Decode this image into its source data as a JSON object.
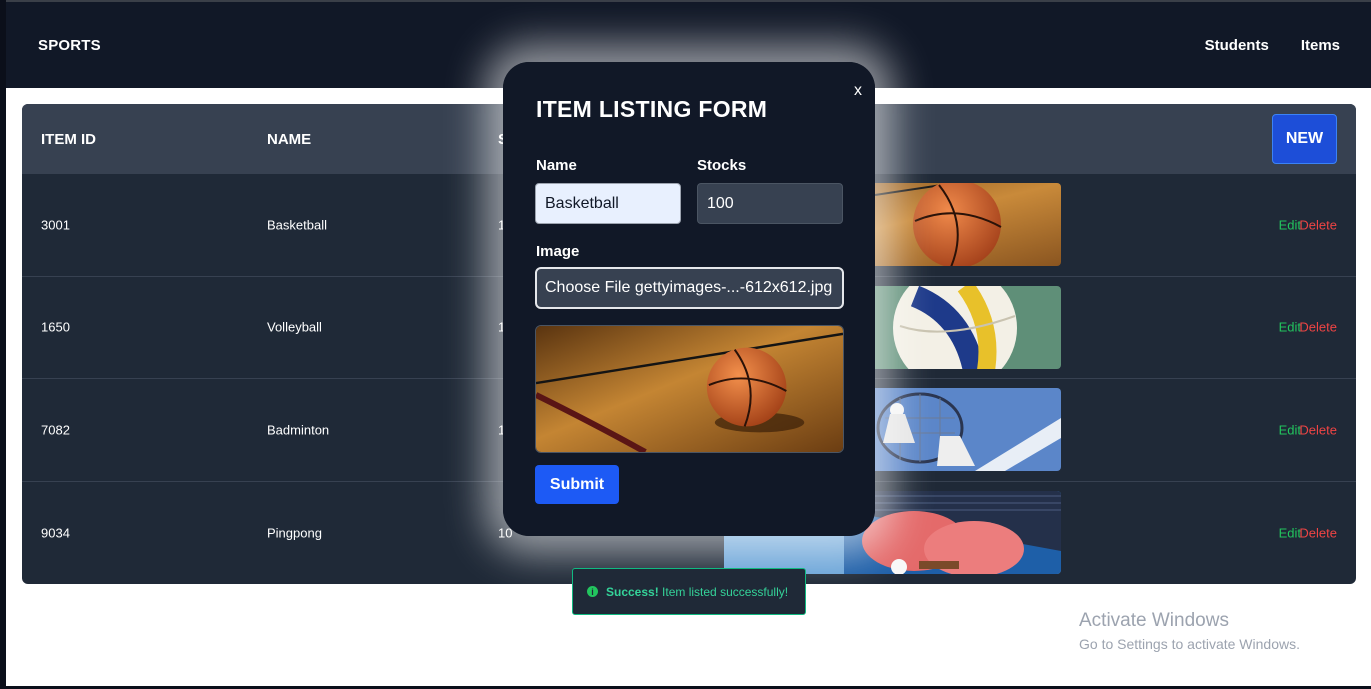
{
  "navbar": {
    "brand": "SPORTS",
    "links": [
      "Students",
      "Items"
    ]
  },
  "table": {
    "columns": [
      "ITEM ID",
      "NAME",
      "S"
    ],
    "new_label": "NEW",
    "rows": [
      {
        "id": "3001",
        "name": "Basketball",
        "stock_partial": "1",
        "image": "basketball",
        "edit": "Edit",
        "delete": "Delete"
      },
      {
        "id": "1650",
        "name": "Volleyball",
        "stock_partial": "1",
        "image": "volleyball",
        "edit": "Edit",
        "delete": "Delete"
      },
      {
        "id": "7082",
        "name": "Badminton",
        "stock_partial": "1",
        "image": "badminton",
        "edit": "Edit",
        "delete": "Delete"
      },
      {
        "id": "9034",
        "name": "Pingpong",
        "stock_partial": "10",
        "image": "pingpong",
        "edit": "Edit",
        "delete": "Delete"
      }
    ]
  },
  "modal": {
    "title": "ITEM LISTING FORM",
    "close_label": "x",
    "name_label": "Name",
    "name_value": "Basketball",
    "stocks_label": "Stocks",
    "stocks_value": "100",
    "image_label": "Image",
    "file_text": "Choose File gettyimages-...-612x612.jpg",
    "preview_image": "basketball",
    "submit_label": "Submit"
  },
  "toast": {
    "icon": "info-icon",
    "strong": "Success!",
    "message": "Item listed successfully!"
  },
  "watermark": {
    "title": "Activate Windows",
    "subtitle": "Go to Settings to activate Windows."
  },
  "colors": {
    "navbar_bg": "#111827",
    "table_bg": "#1f2937",
    "header_bg": "#374151",
    "accent_blue": "#1d4ed8",
    "edit_green": "#22c55e",
    "delete_red": "#ef4444"
  }
}
